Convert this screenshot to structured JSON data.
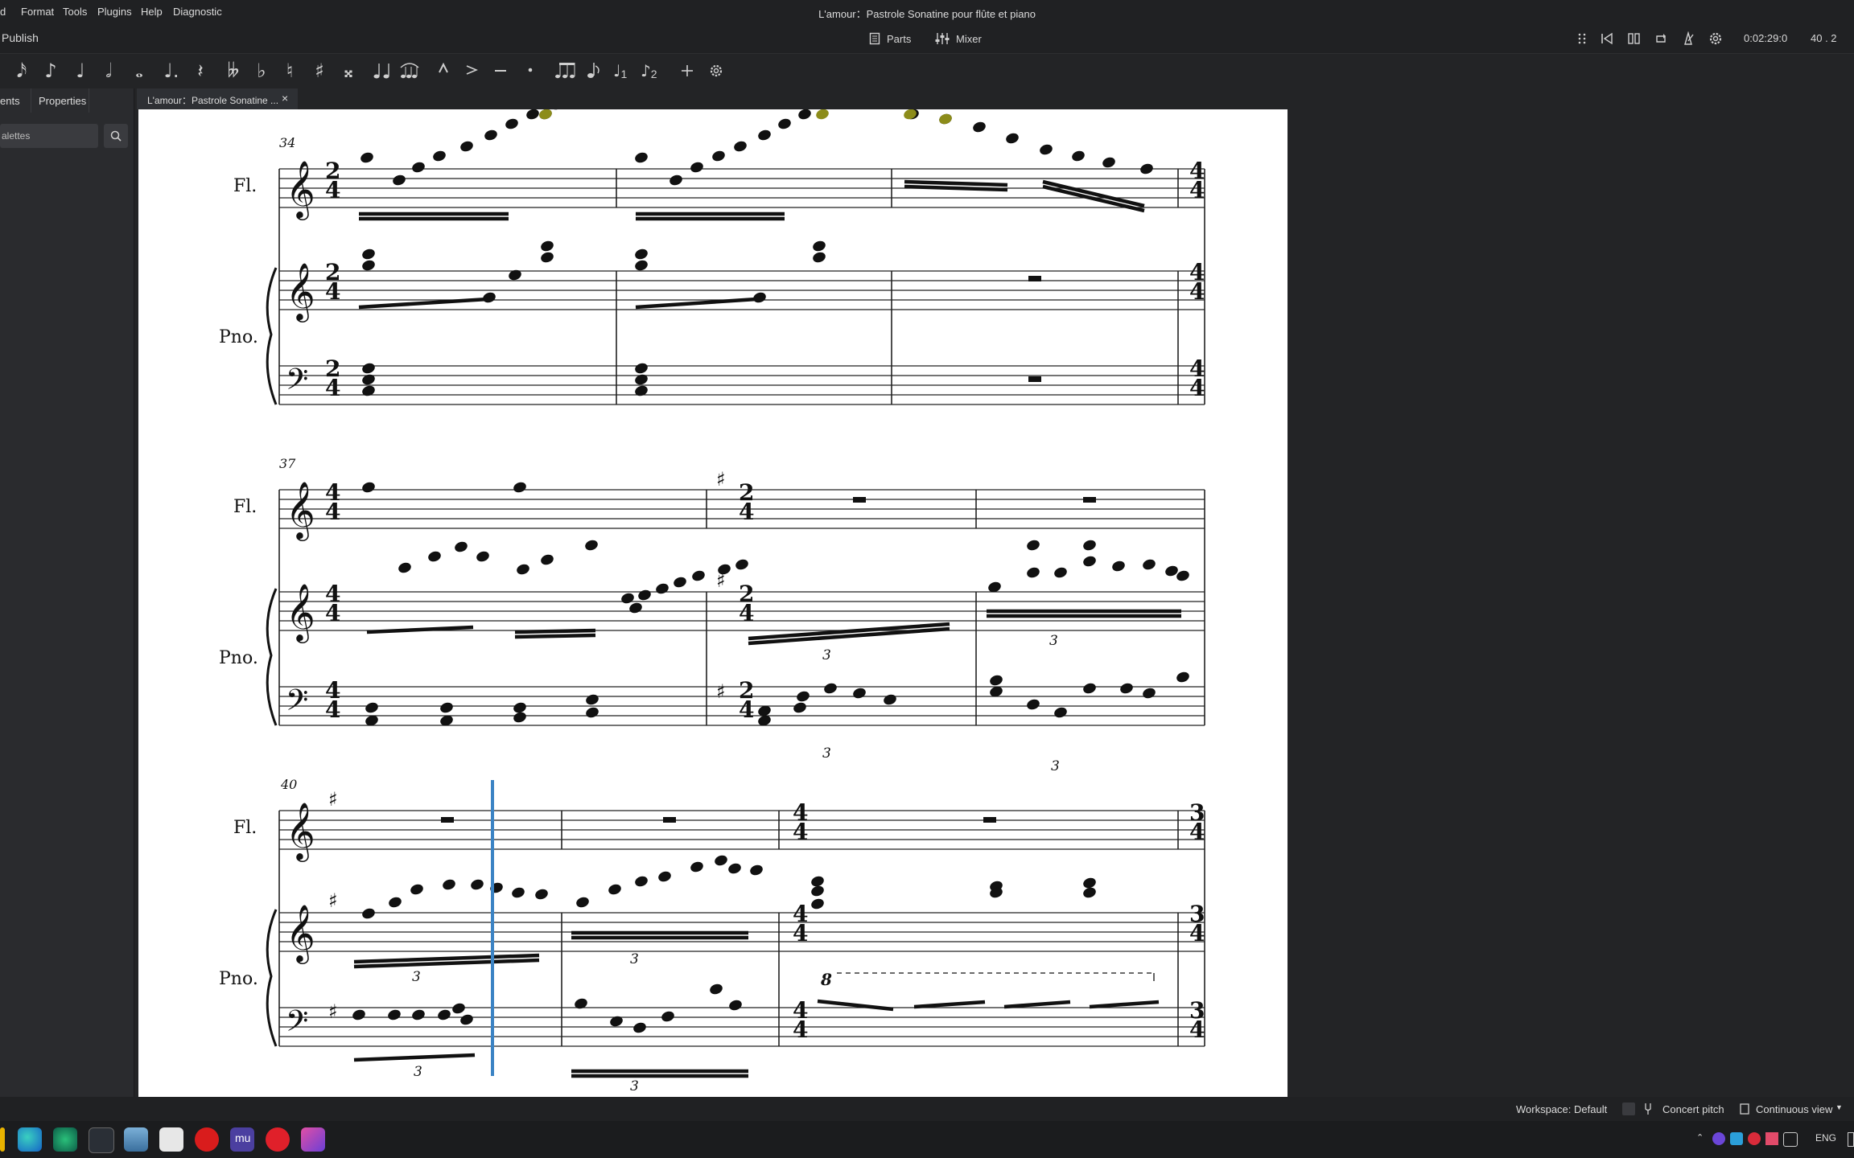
{
  "menu": {
    "items": [
      "d",
      "Format",
      "Tools",
      "Plugins",
      "Help",
      "Diagnostic"
    ]
  },
  "window_title": "L'amour：Pastrole Sonatine pour flûte et piano",
  "toolbar": {
    "publish": "Publish",
    "parts": "Parts",
    "mixer": "Mixer",
    "time": "0:02:29:0",
    "position": "40 . 2"
  },
  "palette": {
    "note_glyphs": [
      "𝅘𝅥𝅯",
      "♪",
      "♩",
      "𝅗𝅥",
      "𝅝",
      "♩.",
      "𝄽",
      "𝄫",
      "♭",
      "♮",
      "♯",
      "𝄪"
    ],
    "voice1": "1",
    "voice2": "2"
  },
  "panel": {
    "tab_instruments": "ents",
    "tab_properties": "Properties",
    "search_placeholder": "alettes"
  },
  "document_tab": {
    "label": "L'amour：Pastrole Sonatine ...",
    "close": "×"
  },
  "score": {
    "instrument_flute": "Fl.",
    "instrument_piano": "Pno.",
    "measure_numbers": [
      "34",
      "37",
      "40"
    ],
    "tuplet": "3",
    "ottava": "8"
  },
  "status": {
    "workspace": "Workspace: Default",
    "concert_pitch": "Concert pitch",
    "view_mode": "Continuous view"
  },
  "tray": {
    "lang": "ENG"
  },
  "colors": {
    "accent": "#3b83c4",
    "selected_note": "#8c8c1a",
    "chrome_bg": "#202123"
  }
}
